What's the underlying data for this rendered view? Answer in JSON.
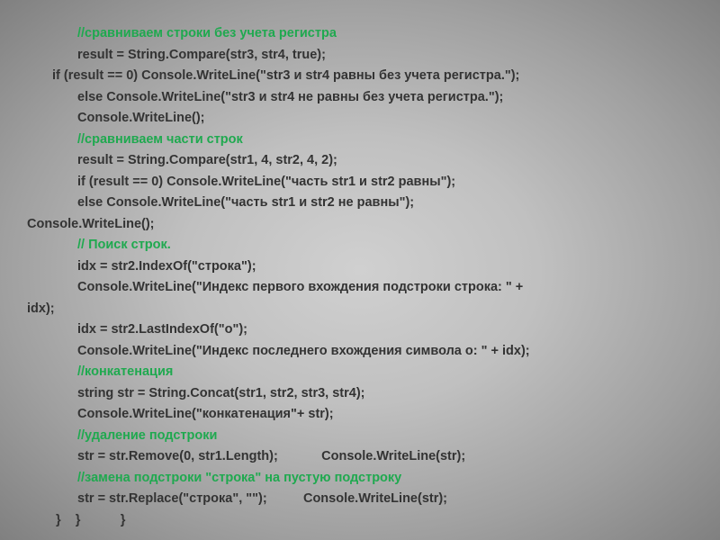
{
  "code": {
    "lines": [
      {
        "cls": "comment",
        "indent": "ind3",
        "text": "//сравниваем строки без учета регистра"
      },
      {
        "cls": "",
        "indent": "ind3",
        "text": "result = String.Compare(str3, str4, true);"
      },
      {
        "cls": "",
        "indent": "ind1",
        "text": "if (result == 0) Console.WriteLine(\"str3 и str4 равны без учета регистра.\");"
      },
      {
        "cls": "",
        "indent": "ind3",
        "text": "else Console.WriteLine(\"str3 и str4 не равны без учета регистра.\");"
      },
      {
        "cls": "",
        "indent": "ind3",
        "text": "Console.WriteLine();"
      },
      {
        "cls": "comment",
        "indent": "ind3",
        "text": "//сравниваем части строк"
      },
      {
        "cls": "",
        "indent": "ind3",
        "text": "result = String.Compare(str1, 4, str2, 4, 2);"
      },
      {
        "cls": "",
        "indent": "ind3",
        "text": "if (result == 0) Console.WriteLine(\"часть str1 и str2 равны\");"
      },
      {
        "cls": "",
        "indent": "ind3",
        "text": "else Console.WriteLine(\"часть str1 и str2 не равны\");"
      },
      {
        "cls": "",
        "indent": "ind0",
        "text": "Console.WriteLine();"
      },
      {
        "cls": "comment",
        "indent": "ind3",
        "text": "// Поиск строк."
      },
      {
        "cls": "",
        "indent": "ind3",
        "text": "idx = str2.IndexOf(\"строка\");"
      },
      {
        "cls": "",
        "indent": "ind3",
        "text": "Console.WriteLine(\"Индекс первого вхождения подстроки строка: \" + "
      },
      {
        "cls": "",
        "indent": "ind0",
        "text": "idx);"
      },
      {
        "cls": "",
        "indent": "ind3",
        "text": "idx = str2.LastIndexOf(\"о\");"
      },
      {
        "cls": "",
        "indent": "ind3",
        "text": "Console.WriteLine(\"Индекс последнего вхождения символа о: \" + idx);"
      },
      {
        "cls": "comment",
        "indent": "ind3",
        "text": "//конкатенация"
      },
      {
        "cls": "",
        "indent": "ind3",
        "text": "string str = String.Concat(str1, str2, str3, str4);"
      },
      {
        "cls": "",
        "indent": "ind3",
        "text": "Console.WriteLine(\"конкатенация\"+ str);"
      },
      {
        "cls": "comment",
        "indent": "ind3",
        "text": "//удаление подстроки"
      },
      {
        "cls": "",
        "indent": "ind3",
        "text": "str = str.Remove(0, str1.Length);            Console.WriteLine(str);"
      },
      {
        "cls": "comment",
        "indent": "ind3",
        "text": "//замена подстроки \"строка\" на пустую подстроку"
      },
      {
        "cls": "",
        "indent": "ind3",
        "text": "str = str.Replace(\"строка\", \"\");          Console.WriteLine(str);"
      },
      {
        "cls": "",
        "indent": "ind1",
        "text": " }    }           }"
      }
    ]
  }
}
